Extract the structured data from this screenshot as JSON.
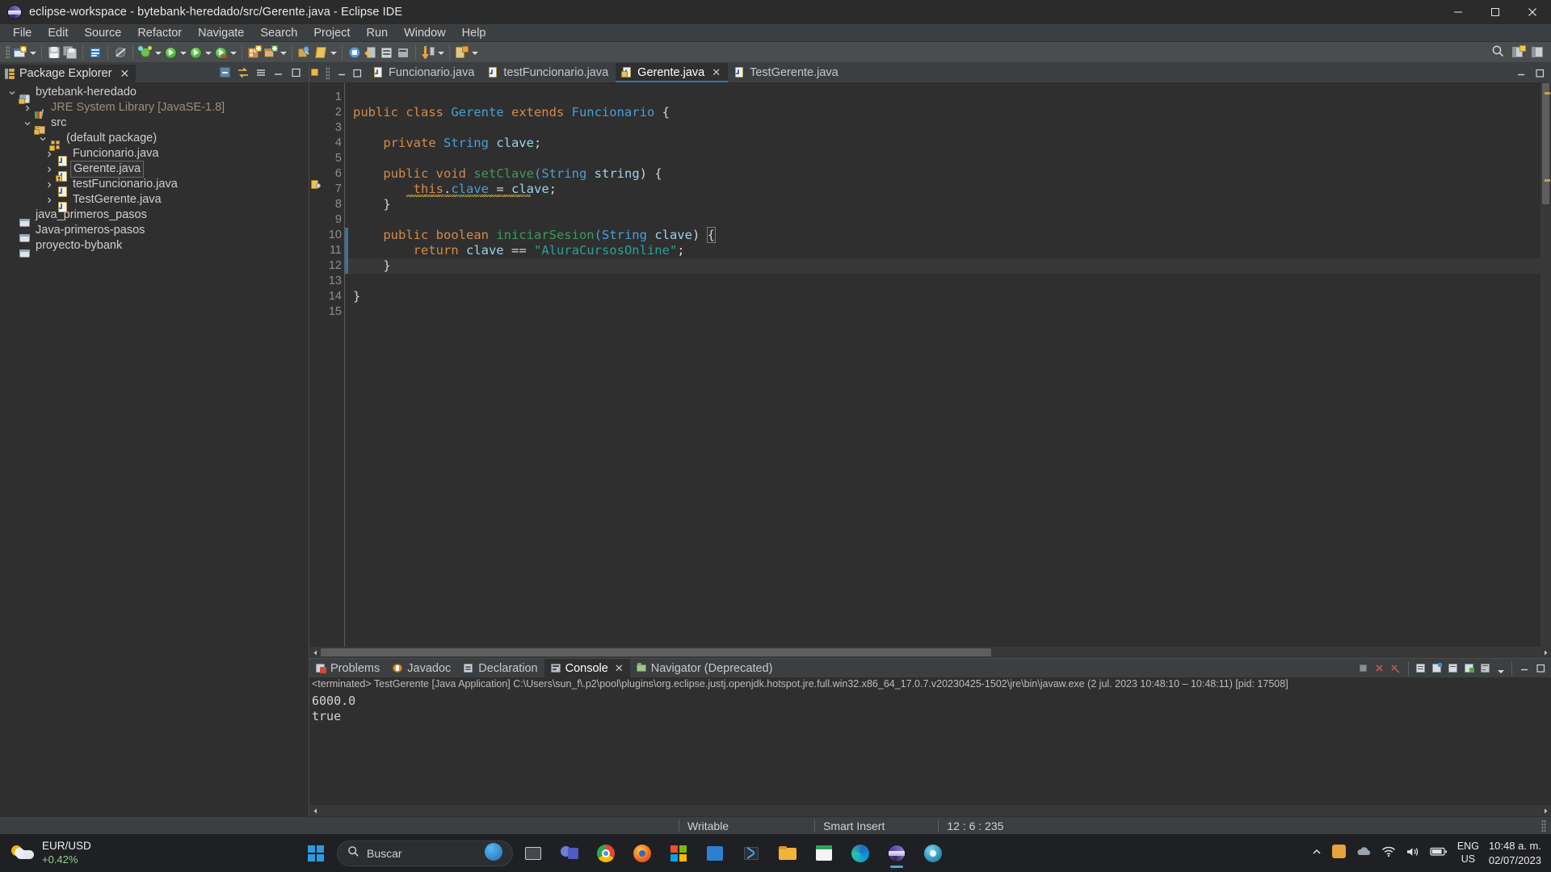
{
  "window": {
    "title": "eclipse-workspace - bytebank-heredado/src/Gerente.java - Eclipse IDE",
    "app_icon": "eclipse-icon",
    "controls": {
      "minimize": "minimize-icon",
      "maximize": "maximize-icon",
      "close": "close-icon"
    }
  },
  "menubar": {
    "items": [
      "File",
      "Edit",
      "Source",
      "Refactor",
      "Navigate",
      "Search",
      "Project",
      "Run",
      "Window",
      "Help"
    ]
  },
  "toolbar": {
    "groups": [
      {
        "icons": [
          "new-wizard-icon",
          "dropdown-arrow"
        ]
      },
      {
        "icons": [
          "save-icon",
          "save-all-icon"
        ]
      },
      {
        "icons": [
          "new-java-class-icon"
        ]
      },
      {
        "icons": [
          "skip-breakpoints-icon"
        ]
      },
      {
        "icons": [
          "debug-icon",
          "dropdown-arrow"
        ]
      },
      {
        "icons": [
          "run-icon",
          "dropdown-arrow"
        ]
      },
      {
        "icons": [
          "run-external-tools-icon",
          "dropdown-arrow"
        ]
      },
      {
        "icons": [
          "coverage-icon",
          "dropdown-arrow"
        ]
      },
      {
        "icons": [
          "new-java-project-icon",
          "new-package-icon",
          "dropdown-arrow"
        ]
      },
      {
        "icons": [
          "open-type-icon",
          "search-icon",
          "dropdown-arrow"
        ]
      },
      {
        "icons": [
          "previous-annotation-icon",
          "next-annotation-icon",
          "last-edit-icon"
        ]
      },
      {
        "icons": [
          "back-icon",
          "forward-icon",
          "pin-icon"
        ]
      },
      {
        "icons": [
          "perspective-icon"
        ]
      }
    ],
    "right_icons": [
      "quick-access-search-icon",
      "open-perspective-icon",
      "java-perspective-icon"
    ]
  },
  "package_explorer": {
    "tab_label": "Package Explorer",
    "tab_icon": "package-explorer-icon",
    "close_icon": "close-icon",
    "view_tools": [
      "collapse-all-icon",
      "link-with-editor-icon",
      "view-menu-icon",
      "minimize-icon",
      "maximize-icon"
    ],
    "tree": [
      {
        "label": "bytebank-heredado",
        "depth": 0,
        "twisty": "expanded",
        "icon": "java-project-icon",
        "selected": false
      },
      {
        "label": "JRE System Library [JavaSE-1.8]",
        "depth": 1,
        "twisty": "collapsed",
        "icon": "jre-library-icon",
        "selected": false,
        "dim": true
      },
      {
        "label": "src",
        "depth": 1,
        "twisty": "expanded",
        "icon": "source-folder-icon",
        "selected": false
      },
      {
        "label": "(default package)",
        "depth": 2,
        "twisty": "expanded",
        "icon": "package-icon",
        "selected": false
      },
      {
        "label": "Funcionario.java",
        "depth": 3,
        "twisty": "collapsed",
        "icon": "java-file-icon",
        "selected": false
      },
      {
        "label": "Gerente.java",
        "depth": 3,
        "twisty": "collapsed",
        "icon": "java-file-warning-icon",
        "selected": true
      },
      {
        "label": "testFuncionario.java",
        "depth": 3,
        "twisty": "collapsed",
        "icon": "java-file-icon",
        "selected": false
      },
      {
        "label": "TestGerente.java",
        "depth": 3,
        "twisty": "collapsed",
        "icon": "java-file-icon",
        "selected": false
      },
      {
        "label": "java_primeros_pasos",
        "depth": 0,
        "twisty": "none",
        "icon": "closed-project-icon",
        "selected": false
      },
      {
        "label": "Java-primeros-pasos",
        "depth": 0,
        "twisty": "none",
        "icon": "closed-project-icon",
        "selected": false
      },
      {
        "label": "proyecto-bybank",
        "depth": 0,
        "twisty": "none",
        "icon": "closed-project-icon",
        "selected": false
      }
    ]
  },
  "editor": {
    "tabs": [
      {
        "label": "Funcionario.java",
        "icon": "java-file-icon",
        "active": false,
        "closable": false
      },
      {
        "label": "testFuncionario.java",
        "icon": "java-file-icon",
        "active": false,
        "closable": false
      },
      {
        "label": "Gerente.java",
        "icon": "java-file-warning-icon",
        "active": true,
        "closable": true
      },
      {
        "label": "TestGerente.java",
        "icon": "java-file-icon",
        "active": false,
        "closable": false
      }
    ],
    "close_icon": "close-icon",
    "view_tools": [
      "minimize-icon",
      "maximize-icon"
    ],
    "active_file": "Gerente.java",
    "line_numbers": [
      "1",
      "2",
      "3",
      "4",
      "5",
      "6",
      "7",
      "8",
      "9",
      "10",
      "11",
      "12",
      "13",
      "14",
      "15"
    ],
    "lines": [
      {
        "n": 1,
        "tokens": []
      },
      {
        "n": 2,
        "tokens": [
          {
            "t": "public ",
            "c": "kw"
          },
          {
            "t": "class ",
            "c": "kw"
          },
          {
            "t": "Gerente ",
            "c": "typ"
          },
          {
            "t": "extends ",
            "c": "kw"
          },
          {
            "t": "Funcionario ",
            "c": "typ"
          },
          {
            "t": "{",
            "c": "pun"
          }
        ]
      },
      {
        "n": 3,
        "tokens": []
      },
      {
        "n": 4,
        "tokens": [
          {
            "t": "    ",
            "c": "pun"
          },
          {
            "t": "private ",
            "c": "kw"
          },
          {
            "t": "String ",
            "c": "typ"
          },
          {
            "t": "clave",
            "c": "var"
          },
          {
            "t": ";",
            "c": "pun"
          }
        ]
      },
      {
        "n": 5,
        "tokens": []
      },
      {
        "n": 6,
        "tokens": [
          {
            "t": "    ",
            "c": "pun"
          },
          {
            "t": "public ",
            "c": "kw"
          },
          {
            "t": "void ",
            "c": "kw"
          },
          {
            "t": "setClave",
            "c": "mth"
          },
          {
            "t": "(",
            "c": "typ"
          },
          {
            "t": "String ",
            "c": "typ"
          },
          {
            "t": "string",
            "c": "var"
          },
          {
            "t": ") {",
            "c": "pun"
          }
        ]
      },
      {
        "n": 7,
        "tokens": [
          {
            "t": "        ",
            "c": "pun"
          },
          {
            "t": "this",
            "c": "kw"
          },
          {
            "t": ".",
            "c": "pun"
          },
          {
            "t": "clave",
            "c": "fld"
          },
          {
            "t": " = ",
            "c": "pun"
          },
          {
            "t": "clave",
            "c": "var"
          },
          {
            "t": ";",
            "c": "pun"
          }
        ]
      },
      {
        "n": 8,
        "tokens": [
          {
            "t": "    }",
            "c": "pun"
          }
        ]
      },
      {
        "n": 9,
        "tokens": []
      },
      {
        "n": 10,
        "tokens": [
          {
            "t": "    ",
            "c": "pun"
          },
          {
            "t": "public ",
            "c": "kw"
          },
          {
            "t": "boolean ",
            "c": "kw"
          },
          {
            "t": "iniciarSesion",
            "c": "mth"
          },
          {
            "t": "(",
            "c": "typ"
          },
          {
            "t": "String ",
            "c": "typ"
          },
          {
            "t": "clave",
            "c": "var"
          },
          {
            "t": ") ",
            "c": "pun"
          },
          {
            "t": "{",
            "c": "pun"
          }
        ]
      },
      {
        "n": 11,
        "tokens": [
          {
            "t": "        ",
            "c": "pun"
          },
          {
            "t": "return ",
            "c": "kw"
          },
          {
            "t": "clave ",
            "c": "var"
          },
          {
            "t": "== ",
            "c": "pun"
          },
          {
            "t": "\"AluraCursosOnline\"",
            "c": "str"
          },
          {
            "t": ";",
            "c": "pun"
          }
        ]
      },
      {
        "n": 12,
        "tokens": [
          {
            "t": "    }",
            "c": "pun"
          }
        ]
      },
      {
        "n": 13,
        "tokens": []
      },
      {
        "n": 14,
        "tokens": [
          {
            "t": "}",
            "c": "pun"
          }
        ]
      },
      {
        "n": 15,
        "tokens": []
      }
    ],
    "markers": {
      "folding_lines": [
        6,
        10
      ],
      "quickfix_line": 7,
      "warning_underline_line": 7,
      "change_bar_lines": [
        10,
        11,
        12
      ],
      "highlighted_line": 12
    },
    "colors": {
      "keyword": "#d58b4a",
      "type": "#4a9fd4",
      "method": "#3c9a5f",
      "string": "#2aa198",
      "plain": "#d4d4d4",
      "field": "#4a9fd4",
      "background": "#2f2f2f",
      "line_number": "#8e8e8e",
      "active_tab_underline": "#2a7ab0"
    }
  },
  "console_panel": {
    "tabs": [
      {
        "label": "Problems",
        "icon": "problems-icon",
        "active": false
      },
      {
        "label": "Javadoc",
        "icon": "javadoc-icon",
        "active": false
      },
      {
        "label": "Declaration",
        "icon": "declaration-icon",
        "active": false
      },
      {
        "label": "Console",
        "icon": "console-icon",
        "active": true
      },
      {
        "label": "Navigator (Deprecated)",
        "icon": "navigator-icon",
        "active": false
      }
    ],
    "close_icon": "close-icon",
    "tools": [
      "terminate-icon",
      "remove-launch-icon",
      "remove-all-terminated-icon",
      "scroll-lock-icon",
      "pin-console-icon",
      "display-selected-console-icon",
      "open-console-icon",
      "word-wrap-icon",
      "dropdown-arrow",
      "minimize-icon",
      "maximize-icon"
    ],
    "header": "<terminated> TestGerente [Java Application] C:\\Users\\sun_f\\.p2\\pool\\plugins\\org.eclipse.justj.openjdk.hotspot.jre.full.win32.x86_64_17.0.7.v20230425-1502\\jre\\bin\\javaw.exe  (2 jul. 2023 10:48:10 – 10:48:11) [pid: 17508]",
    "output": [
      "6000.0",
      "true"
    ]
  },
  "statusbar": {
    "writable": "Writable",
    "insert_mode": "Smart Insert",
    "position": "12 : 6 : 235"
  },
  "taskbar": {
    "weather": {
      "label": "EUR/USD",
      "change": "+0.42%",
      "icon": "weather-icon"
    },
    "start_icon": "windows-start-icon",
    "search": {
      "placeholder": "Buscar",
      "icon": "search-icon",
      "assistant_icon": "copilot-icon"
    },
    "pinned": [
      {
        "name": "task-view-icon"
      },
      {
        "name": "teams-icon"
      },
      {
        "name": "chrome-icon"
      },
      {
        "name": "firefox-icon"
      },
      {
        "name": "microsoft-store-icon"
      },
      {
        "name": "file-explorer-blue-icon"
      },
      {
        "name": "vscode-icon"
      },
      {
        "name": "folder-icon"
      },
      {
        "name": "calendar-icon"
      },
      {
        "name": "edge-icon"
      },
      {
        "name": "eclipse-icon"
      },
      {
        "name": "settings-gear-icon"
      }
    ],
    "tray": {
      "chevron_icon": "show-hidden-icons-icon",
      "icons": [
        "app-tray-icon",
        "onedrive-icon",
        "wifi-icon",
        "volume-icon",
        "battery-icon"
      ],
      "language": {
        "line1": "ENG",
        "line2": "US"
      },
      "clock": {
        "time": "10:48 a. m.",
        "date": "02/07/2023"
      }
    }
  }
}
